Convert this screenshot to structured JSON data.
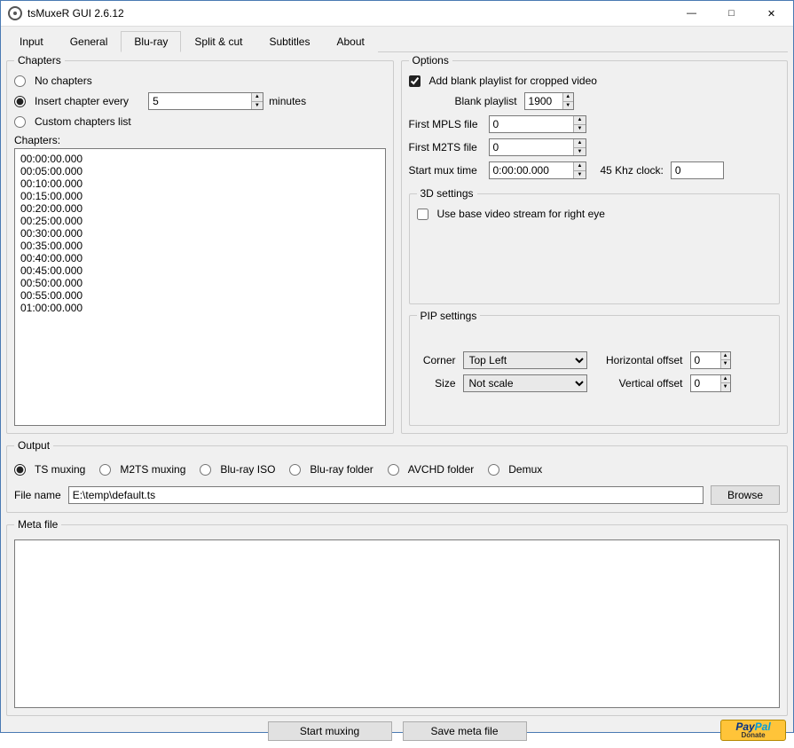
{
  "window": {
    "title": "tsMuxeR GUI 2.6.12"
  },
  "tabs": [
    "Input",
    "General",
    "Blu-ray",
    "Split & cut",
    "Subtitles",
    "About"
  ],
  "chapters": {
    "legend": "Chapters",
    "no_chapters": "No chapters",
    "insert_every": "Insert chapter every",
    "insert_value": "5",
    "insert_unit": "minutes",
    "custom_list": "Custom chapters list",
    "list_label": "Chapters:",
    "list": "00:00:00.000\n00:05:00.000\n00:10:00.000\n00:15:00.000\n00:20:00.000\n00:25:00.000\n00:30:00.000\n00:35:00.000\n00:40:00.000\n00:45:00.000\n00:50:00.000\n00:55:00.000\n01:00:00.000"
  },
  "options": {
    "legend": "Options",
    "add_blank": "Add blank playlist for cropped video",
    "blank_playlist_label": "Blank playlist",
    "blank_playlist": "1900",
    "first_mpls_label": "First MPLS file",
    "first_mpls": "0",
    "first_m2ts_label": "First M2TS file",
    "first_m2ts": "0",
    "start_mux_label": "Start mux time",
    "start_mux": "0:00:00.000",
    "clock45_label": "45 Khz clock:",
    "clock45": "0",
    "threeD": {
      "legend": "3D settings",
      "use_base": "Use base video stream for right eye"
    },
    "pip": {
      "legend": "PIP settings",
      "corner_label": "Corner",
      "corner": "Top Left",
      "size_label": "Size",
      "size": "Not scale",
      "hoff_label": "Horizontal offset",
      "hoff": "0",
      "voff_label": "Vertical offset",
      "voff": "0"
    }
  },
  "output": {
    "legend": "Output",
    "radios": [
      "TS muxing",
      "M2TS muxing",
      "Blu-ray ISO",
      "Blu-ray folder",
      "AVCHD folder",
      "Demux"
    ],
    "filename_label": "File name",
    "filename": "E:\\temp\\default.ts",
    "browse": "Browse"
  },
  "meta": {
    "legend": "Meta file"
  },
  "buttons": {
    "start": "Start muxing",
    "save": "Save meta file"
  },
  "paypal": {
    "brand1": "Pay",
    "brand2": "Pal",
    "donate": "Donate"
  }
}
